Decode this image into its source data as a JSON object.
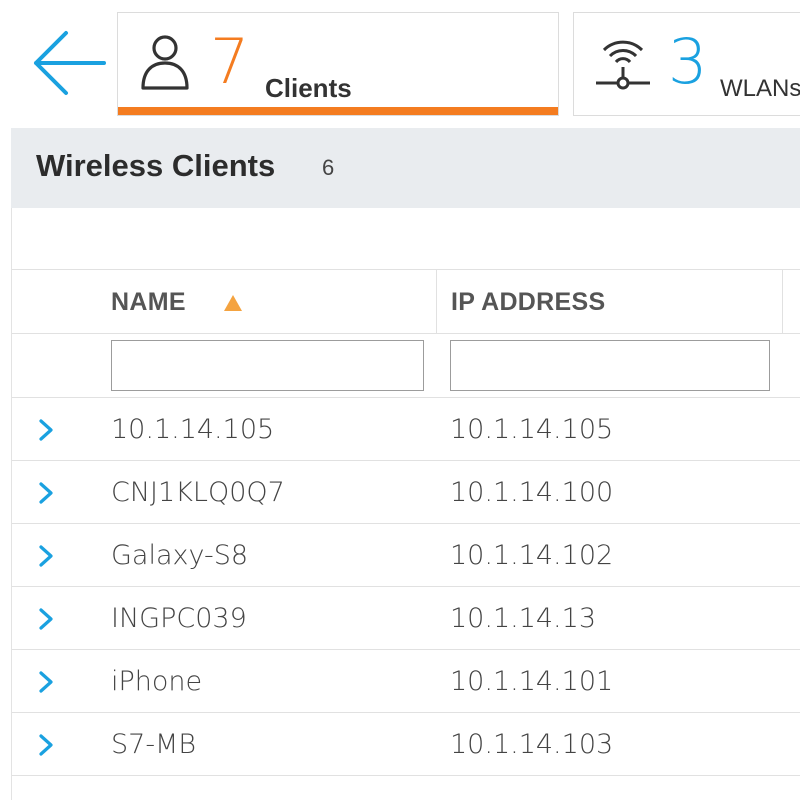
{
  "nav": {
    "back_icon": "arrow-left-icon",
    "accent_orange": "#f47c20",
    "accent_blue": "#1aa1e0"
  },
  "tabs": [
    {
      "icon": "user-icon",
      "count": "7",
      "label": "Clients",
      "active": true
    },
    {
      "icon": "wifi-access-point-icon",
      "count": "3",
      "label": "WLANs",
      "active": false
    }
  ],
  "panel": {
    "title": "Wireless Clients",
    "count": "6"
  },
  "table": {
    "columns": [
      {
        "label": "NAME",
        "sort": "ascending"
      },
      {
        "label": "IP ADDRESS"
      }
    ],
    "filters": {
      "name": "",
      "ip": ""
    },
    "rows": [
      {
        "name": "10.1.14.105",
        "ip": "10.1.14.105"
      },
      {
        "name": "CNJ1KLQ0Q7",
        "ip": "10.1.14.100"
      },
      {
        "name": "Galaxy-S8",
        "ip": "10.1.14.102"
      },
      {
        "name": "INGPC039",
        "ip": "10.1.14.13"
      },
      {
        "name": "iPhone",
        "ip": "10.1.14.101"
      },
      {
        "name": "S7-MB",
        "ip": "10.1.14.103"
      }
    ]
  }
}
